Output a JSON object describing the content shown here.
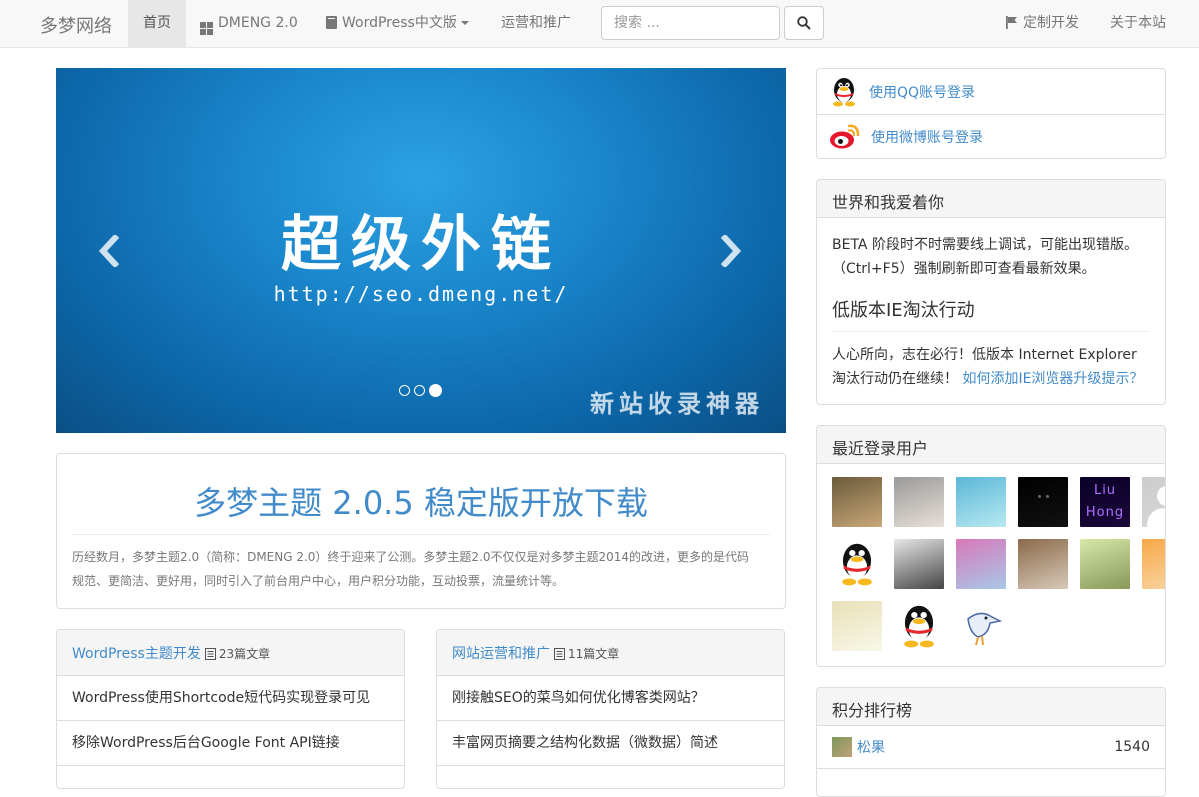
{
  "navbar": {
    "brand": "多梦网络",
    "home": "首页",
    "dmeng": "DMENG 2.0",
    "wordpress": "WordPress中文版",
    "marketing": "运营和推广",
    "search_placeholder": "搜索 ...",
    "custom": "定制开发",
    "about": "关于本站"
  },
  "carousel": {
    "title": "超级外链",
    "url": "http://seo.dmeng.net/",
    "subtitle": "新站收录神器",
    "slide_count": 3,
    "active_slide": 3
  },
  "announce": {
    "title": "多梦主题 2.0.5 稳定版开放下载",
    "text": "历经数月，多梦主题2.0（简称：DMENG 2.0）终于迎来了公测。多梦主题2.0不仅仅是对多梦主题2014的改进，更多的是代码规范、更简洁、更好用，同时引入了前台用户中心，用户积分功能，互动投票，流量统计等。"
  },
  "categories": [
    {
      "name": "WordPress主题开发",
      "count": "23篇文章",
      "items": [
        "WordPress使用Shortcode短代码实现登录可见",
        "移除WordPress后台Google Font API链接"
      ]
    },
    {
      "name": "网站运营和推广",
      "count": "11篇文章",
      "items": [
        "刚接触SEO的菜鸟如何优化博客类网站？",
        "丰富网页摘要之结构化数据（微数据）简述"
      ]
    }
  ],
  "login": {
    "qq": "使用QQ账号登录",
    "weibo": "使用微博账号登录"
  },
  "notice": {
    "title": "世界和我爱着你",
    "beta_text": "BETA 阶段时不时需要线上调试，可能出现错版。（Ctrl+F5）强制刷新即可查看最新效果。",
    "ie_title": "低版本IE淘汰行动",
    "ie_text": "人心所向，志在必行！低版本 Internet Explorer 淘汰行动仍在继续！ ",
    "ie_link": "如何添加IE浏览器升级提示？"
  },
  "recent_users": {
    "title": "最近登录用户",
    "avatars": [
      {
        "name": "photo-man",
        "c1": "#6b5a3a",
        "c2": "#c8a878"
      },
      {
        "name": "cat",
        "c1": "#9a9a9a",
        "c2": "#e8e0d8"
      },
      {
        "name": "sky",
        "c1": "#5ab8d8",
        "c2": "#b8e8f0"
      },
      {
        "name": "dark",
        "c1": "#000000",
        "c2": "#111111"
      },
      {
        "name": "liu-hong",
        "c1": "#0a0028",
        "c2": "#1a0838"
      },
      {
        "name": "default",
        "c1": "#cccccc",
        "c2": "#d8d8d8"
      },
      {
        "name": "qq-penguin",
        "c1": "#ffffff",
        "c2": "#ffffff"
      },
      {
        "name": "pose",
        "c1": "#e8e8e8",
        "c2": "#444444"
      },
      {
        "name": "collage",
        "c1": "#d878b8",
        "c2": "#a8c8e8"
      },
      {
        "name": "photo-boy",
        "c1": "#8a6a4a",
        "c2": "#d8c8b8"
      },
      {
        "name": "grass",
        "c1": "#d8e8a8",
        "c2": "#889858"
      },
      {
        "name": "anime",
        "c1": "#f8a848",
        "c2": "#f8d8a8"
      },
      {
        "name": "frame",
        "c1": "#e8e0b8",
        "c2": "#f8f8e8"
      },
      {
        "name": "qq-penguin-2",
        "c1": "#ffffff",
        "c2": "#ffffff"
      },
      {
        "name": "bird",
        "c1": "#ffffff",
        "c2": "#ffffff"
      }
    ],
    "liu_hong_label": "Liu Hong"
  },
  "ranking": {
    "title": "积分排行榜",
    "rows": [
      {
        "name": "松果",
        "score": "1540"
      }
    ]
  }
}
